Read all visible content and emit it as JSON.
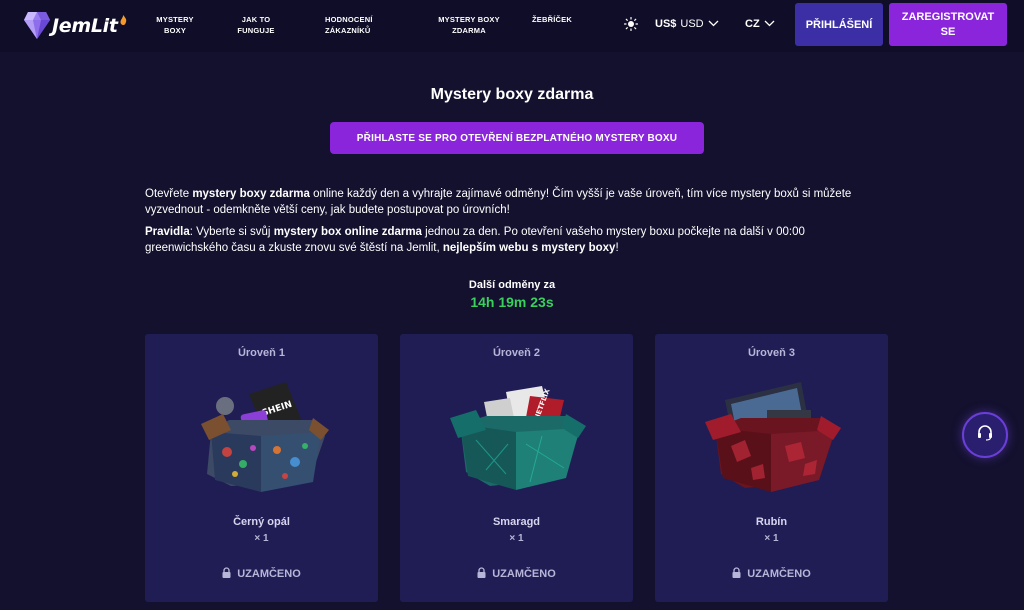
{
  "header": {
    "logo_text": "JemLit",
    "nav": [
      {
        "line1": "MYSTERY",
        "line2": "BOXY"
      },
      {
        "line1": "JAK TO",
        "line2": "FUNGUJE"
      },
      {
        "line1": "HODNOCENÍ",
        "line2": "ZÁKAZNÍKŮ"
      },
      {
        "line1": "MYSTERY BOXY",
        "line2": "ZDARMA"
      },
      {
        "line1": "ŽEBŘÍČEK",
        "line2": ""
      }
    ],
    "theme_icon": "sun-icon",
    "currency_symbol": "US$",
    "currency_code": "USD",
    "language": "CZ",
    "login_label": "PŘIHLÁŠENÍ",
    "register_label": "ZAREGISTROVAT SE"
  },
  "main": {
    "title": "Mystery boxy zdarma",
    "cta_label": "PŘIHLASTE SE PRO OTEVŘENÍ BEZPLATNÉHO MYSTERY BOXU",
    "intro": {
      "p1_a": "Otevřete ",
      "p1_b": "mystery boxy zdarma",
      "p1_c": " online každý den a vyhrajte zajímavé odměny! Čím vyšší je vaše úroveň, tím více mystery boxů si můžete vyzvednout - odemkněte větší ceny, jak budete postupovat po úrovních!",
      "p2_a": "Pravidla",
      "p2_b": ": Vyberte si svůj ",
      "p2_c": "mystery box online zdarma",
      "p2_d": " jednou za den. Po otevření vašeho mystery boxu počkejte na další v 00:00 greenwichského času a zkuste znovu své štěstí na Jemlit, ",
      "p2_e": "nejlepším webu s mystery boxy",
      "p2_f": "!"
    },
    "timer_label": "Další odměny za",
    "timer_value": "14h 19m 23s"
  },
  "cards": [
    {
      "level": "Úroveň 1",
      "name": "Černý opál",
      "qty": "× 1",
      "status": "UZAMČENO",
      "box_color": "#3a5a6a"
    },
    {
      "level": "Úroveň 2",
      "name": "Smaragd",
      "qty": "× 1",
      "status": "UZAMČENO",
      "box_color": "#1f8a7a"
    },
    {
      "level": "Úroveň 3",
      "name": "Rubín",
      "qty": "× 1",
      "status": "UZAMČENO",
      "box_color": "#8a1c2a"
    }
  ],
  "support_icon": "headset-icon",
  "colors": {
    "accent_purple": "#8a25dc",
    "login_blue": "#3c2fa6",
    "timer_green": "#38d15c",
    "card_bg": "#201d55"
  }
}
